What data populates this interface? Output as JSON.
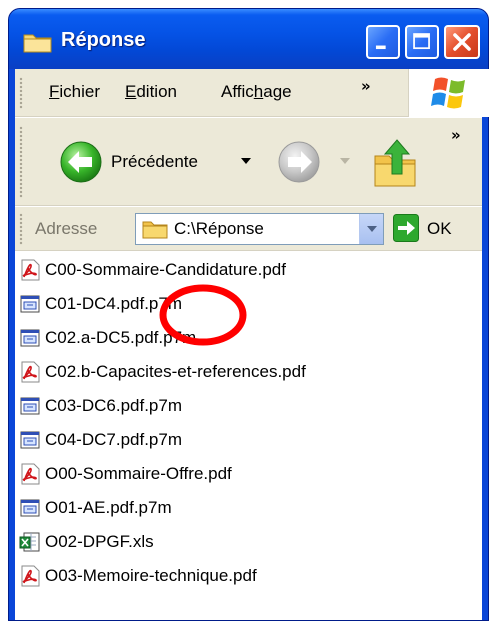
{
  "window": {
    "title": "Réponse",
    "title_icon": "folder-icon",
    "controls": [
      "minimize-icon",
      "maximize-icon",
      "close-icon"
    ]
  },
  "menubar": {
    "items": [
      {
        "label": "Fichier",
        "access_key": "F"
      },
      {
        "label": "Edition",
        "access_key": "E"
      },
      {
        "label": "Affichage",
        "access_key": "h"
      }
    ],
    "overflow": "»",
    "logo": "windows-logo-icon"
  },
  "toolbar": {
    "back_label": "Précédente",
    "overflow": "»",
    "icons": [
      "back-arrow-icon",
      "forward-arrow-icon",
      "folder-up-icon"
    ]
  },
  "address": {
    "label": "Adresse",
    "value": "C:\\Réponse",
    "go_label": "OK"
  },
  "files": [
    {
      "name": "C00-Sommaire-Candidature.pdf",
      "icon": "pdf-icon"
    },
    {
      "name": "C01-DC4.pdf.p7m",
      "icon": "p7m-icon"
    },
    {
      "name": "C02.a-DC5.pdf.p7m",
      "icon": "p7m-icon"
    },
    {
      "name": "C02.b-Capacites-et-references.pdf",
      "icon": "pdf-icon"
    },
    {
      "name": "C03-DC6.pdf.p7m",
      "icon": "p7m-icon"
    },
    {
      "name": "C04-DC7.pdf.p7m",
      "icon": "p7m-icon"
    },
    {
      "name": "O00-Sommaire-Offre.pdf",
      "icon": "pdf-icon"
    },
    {
      "name": "O01-AE.pdf.p7m",
      "icon": "p7m-icon"
    },
    {
      "name": "O02-DPGF.xls",
      "icon": "excel-icon"
    },
    {
      "name": "O03-Memoire-technique.pdf",
      "icon": "pdf-icon"
    }
  ],
  "colors": {
    "titlebar": "#0553e6",
    "chrome": "#ece9d8",
    "annotation": "#ff0000",
    "pdf": "#d0161b",
    "go_arrow": "#2ea82e"
  },
  "annotation": {
    "shape": "circle",
    "target_file": "C01-DC4.pdf.p7m"
  }
}
